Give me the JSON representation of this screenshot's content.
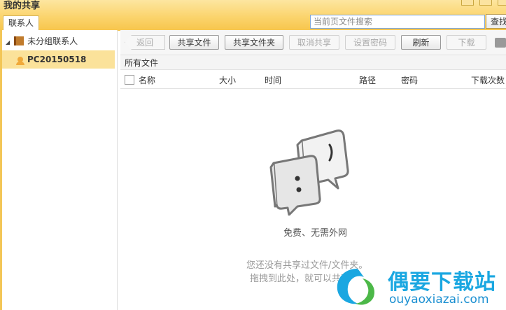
{
  "app": {
    "title": "我的共享"
  },
  "left": {
    "tab_label": "联系人",
    "group_label": "未分组联系人",
    "contact_label": "PC20150518"
  },
  "search": {
    "placeholder": "当前页文件搜索",
    "button_label": "查找"
  },
  "toolbar": {
    "back_label": "返回",
    "share_file_label": "共享文件",
    "share_folder_label": "共享文件夹",
    "cancel_share_label": "取消共享",
    "set_password_label": "设置密码",
    "refresh_label": "刷新",
    "download_label": "下载"
  },
  "path": {
    "label": "所有文件"
  },
  "columns": {
    "name": "名称",
    "size": "大小",
    "time": "时间",
    "path": "路径",
    "password": "密码",
    "downloads": "下载次数"
  },
  "empty": {
    "headline": "免费、无需外网",
    "hint_line1": "您还没有共享过文件/文件夹。",
    "hint_line2": "拖拽到此处，就可以共享"
  },
  "watermark": {
    "cn": "偶要下载站",
    "url": "ouyaoxiazai.com"
  },
  "colors": {
    "title_bar": "#fbd46d",
    "selection": "#fbe29a",
    "watermark_blue": "#1aa7e1",
    "watermark_green": "#4cb848"
  }
}
